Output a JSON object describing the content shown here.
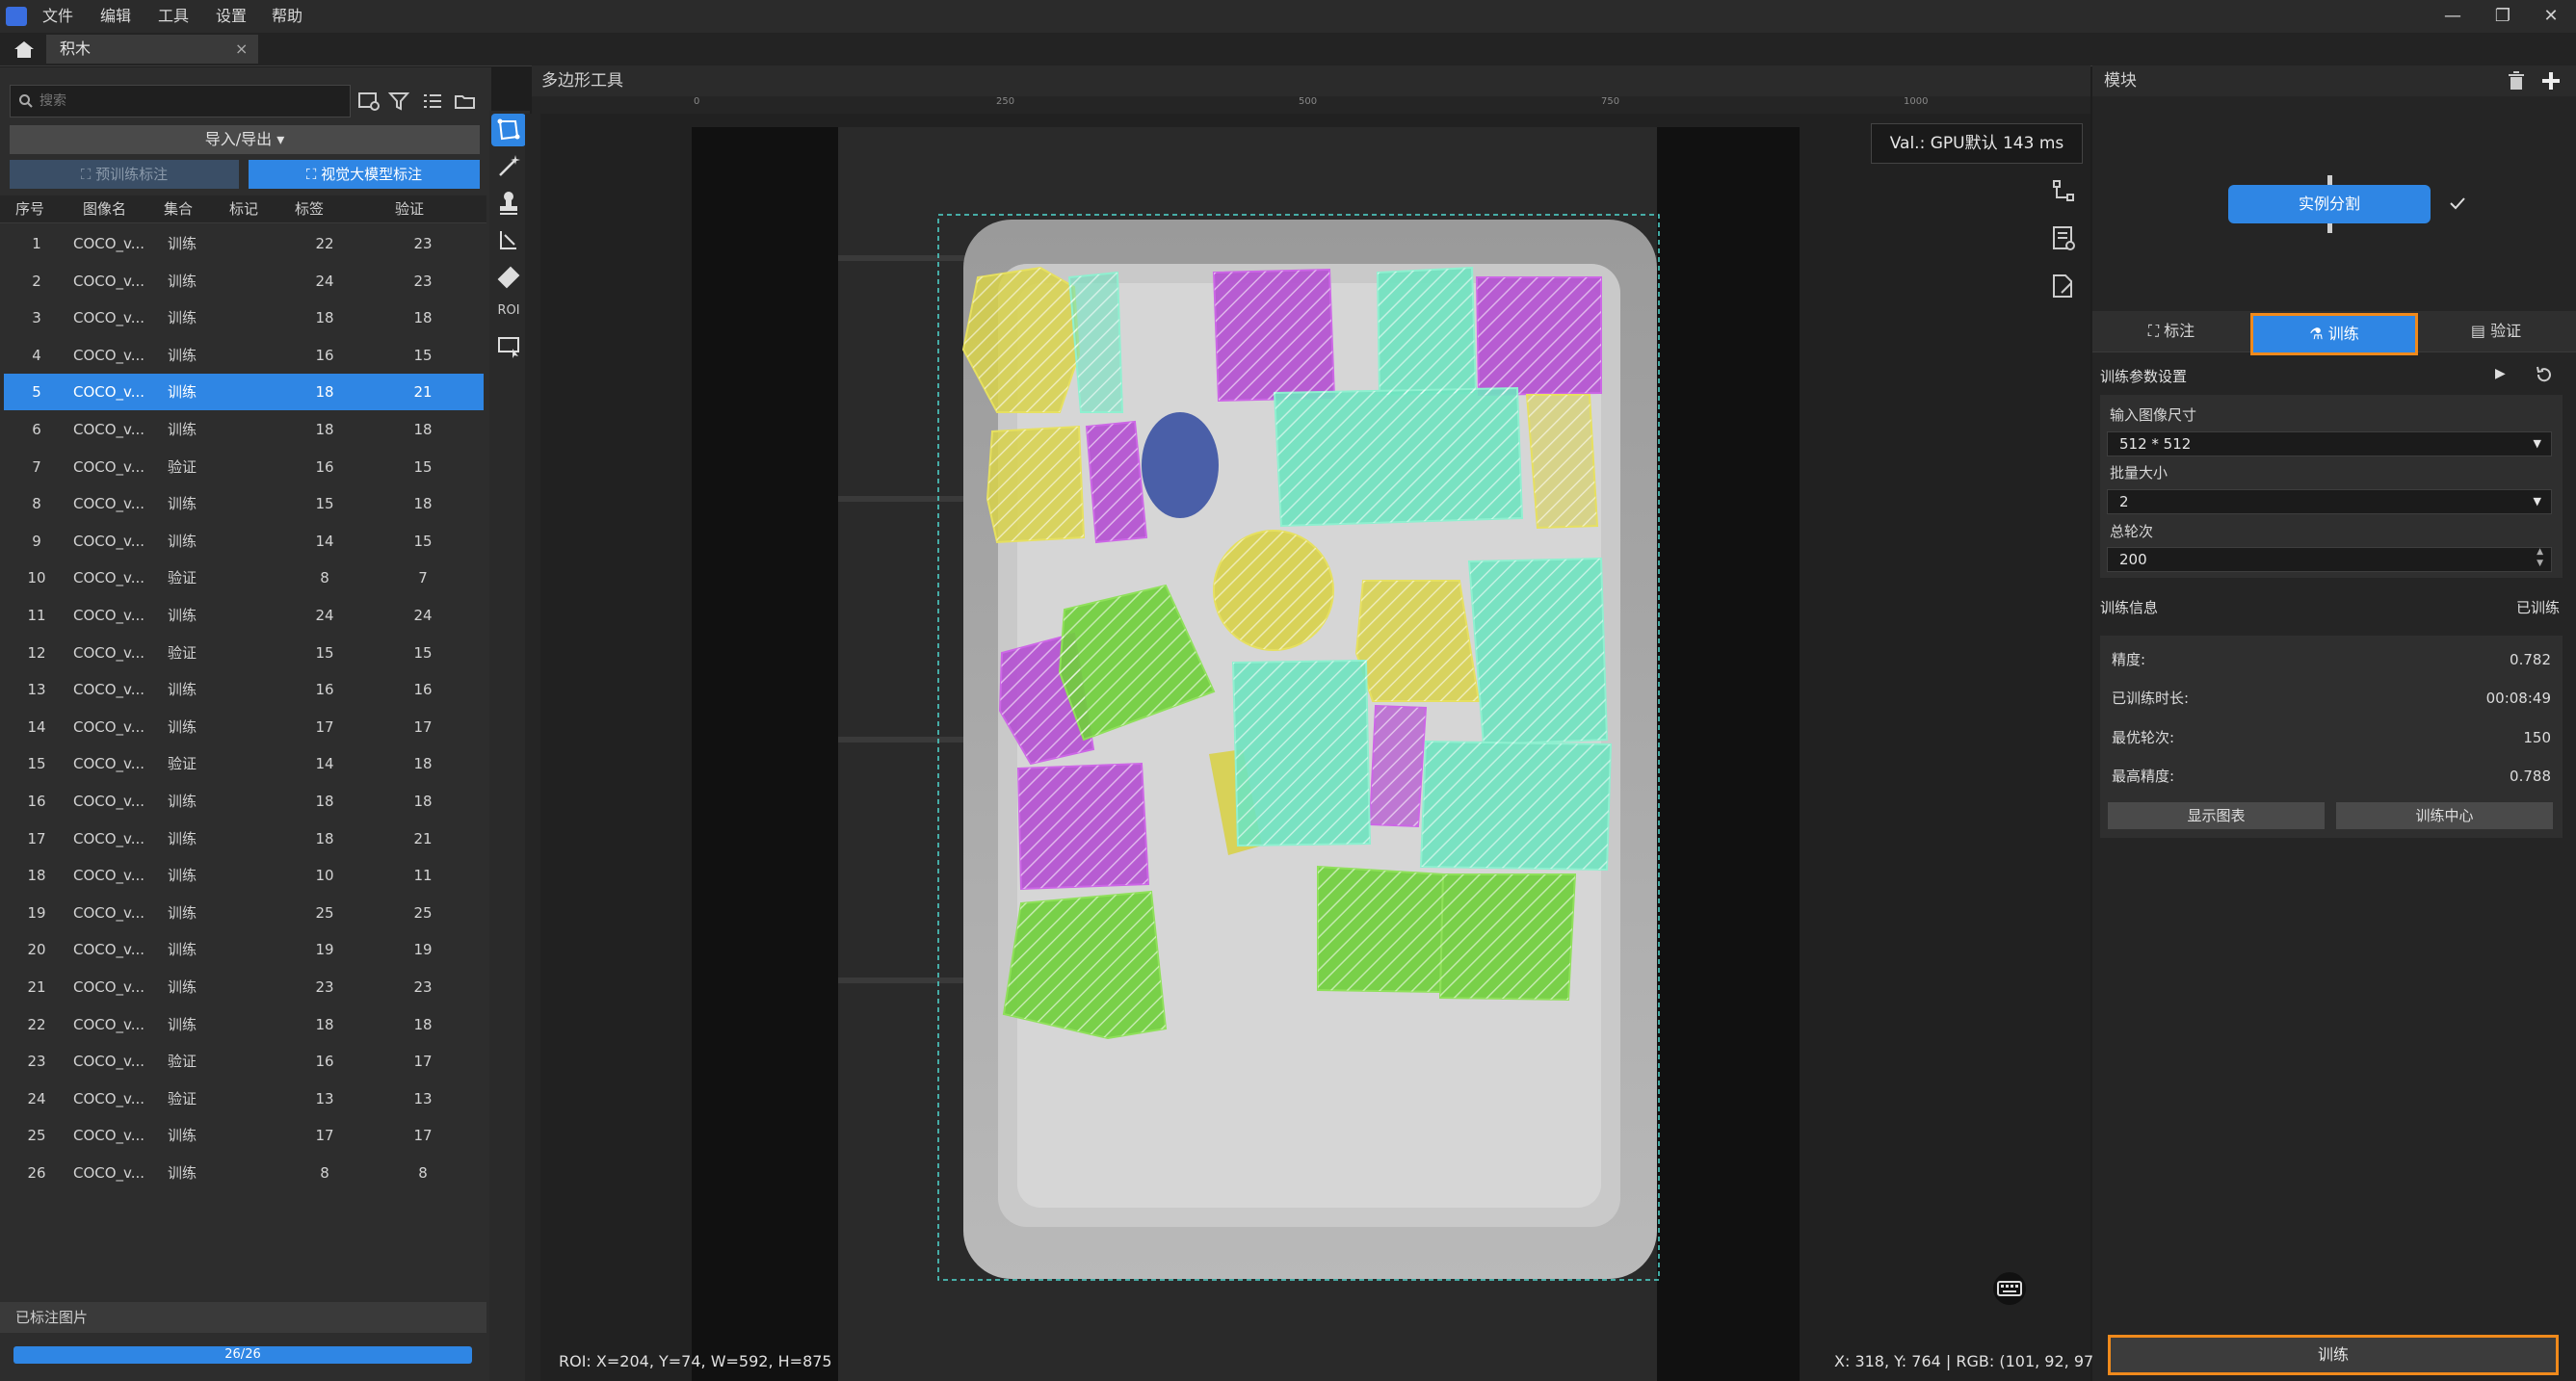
{
  "titlebar": {
    "menus": [
      "文件",
      "编辑",
      "工具",
      "设置",
      "帮助"
    ],
    "window_controls": [
      "—",
      "❐",
      "✕"
    ]
  },
  "document_tab": {
    "label": "积木",
    "close": "×"
  },
  "left": {
    "search": {
      "placeholder": "搜索"
    },
    "import_export_label": "导入/导出 ▾",
    "pretrain_label": "预训练标注",
    "vlm_label": "视觉大模型标注",
    "columns": [
      "序号",
      "图像名",
      "集合",
      "标记",
      "标签",
      "验证"
    ],
    "rows": [
      {
        "no": "1",
        "name": "COCO_v...",
        "set": "训练",
        "mark": "22",
        "verify": "23"
      },
      {
        "no": "2",
        "name": "COCO_v...",
        "set": "训练",
        "mark": "24",
        "verify": "23"
      },
      {
        "no": "3",
        "name": "COCO_v...",
        "set": "训练",
        "mark": "18",
        "verify": "18"
      },
      {
        "no": "4",
        "name": "COCO_v...",
        "set": "训练",
        "mark": "16",
        "verify": "15"
      },
      {
        "no": "5",
        "name": "COCO_v...",
        "set": "训练",
        "mark": "18",
        "verify": "21"
      },
      {
        "no": "6",
        "name": "COCO_v...",
        "set": "训练",
        "mark": "18",
        "verify": "18"
      },
      {
        "no": "7",
        "name": "COCO_v...",
        "set": "验证",
        "mark": "16",
        "verify": "15"
      },
      {
        "no": "8",
        "name": "COCO_v...",
        "set": "训练",
        "mark": "15",
        "verify": "18"
      },
      {
        "no": "9",
        "name": "COCO_v...",
        "set": "训练",
        "mark": "14",
        "verify": "15"
      },
      {
        "no": "10",
        "name": "COCO_v...",
        "set": "验证",
        "mark": "8",
        "verify": "7"
      },
      {
        "no": "11",
        "name": "COCO_v...",
        "set": "训练",
        "mark": "24",
        "verify": "24"
      },
      {
        "no": "12",
        "name": "COCO_v...",
        "set": "验证",
        "mark": "15",
        "verify": "15"
      },
      {
        "no": "13",
        "name": "COCO_v...",
        "set": "训练",
        "mark": "16",
        "verify": "16"
      },
      {
        "no": "14",
        "name": "COCO_v...",
        "set": "训练",
        "mark": "17",
        "verify": "17"
      },
      {
        "no": "15",
        "name": "COCO_v...",
        "set": "验证",
        "mark": "14",
        "verify": "18"
      },
      {
        "no": "16",
        "name": "COCO_v...",
        "set": "训练",
        "mark": "18",
        "verify": "18"
      },
      {
        "no": "17",
        "name": "COCO_v...",
        "set": "训练",
        "mark": "18",
        "verify": "21"
      },
      {
        "no": "18",
        "name": "COCO_v...",
        "set": "训练",
        "mark": "10",
        "verify": "11"
      },
      {
        "no": "19",
        "name": "COCO_v...",
        "set": "训练",
        "mark": "25",
        "verify": "25"
      },
      {
        "no": "20",
        "name": "COCO_v...",
        "set": "训练",
        "mark": "19",
        "verify": "19"
      },
      {
        "no": "21",
        "name": "COCO_v...",
        "set": "训练",
        "mark": "23",
        "verify": "23"
      },
      {
        "no": "22",
        "name": "COCO_v...",
        "set": "训练",
        "mark": "18",
        "verify": "18"
      },
      {
        "no": "23",
        "name": "COCO_v...",
        "set": "验证",
        "mark": "16",
        "verify": "17"
      },
      {
        "no": "24",
        "name": "COCO_v...",
        "set": "验证",
        "mark": "13",
        "verify": "13"
      },
      {
        "no": "25",
        "name": "COCO_v...",
        "set": "训练",
        "mark": "17",
        "verify": "17"
      },
      {
        "no": "26",
        "name": "COCO_v...",
        "set": "训练",
        "mark": "8",
        "verify": "8"
      }
    ],
    "selected_row": "5",
    "labeled_title": "已标注图片",
    "progress_text": "26/26",
    "progress": 1.0
  },
  "center": {
    "title": "多边形工具",
    "ruler_ticks": [
      "0",
      "250",
      "500",
      "750",
      "1000"
    ],
    "val_text": "Val.: GPU默认 143 ms",
    "roi_text": "ROI: X=204, Y=74, W=592, H=875",
    "roi_tool_label": "ROI",
    "xy_text": "X: 318, Y: 764 | RGB: (101, 92, 97)"
  },
  "right": {
    "title": "模块",
    "module_label": "实例分割",
    "tabs": [
      "标注",
      "训练",
      "验证"
    ],
    "params_title": "训练参数设置",
    "input_size_label": "输入图像尺寸",
    "input_size_value": "512 * 512",
    "batch_label": "批量大小",
    "batch_value": "2",
    "epochs_label": "总轮次",
    "epochs_value": "200",
    "info_title": "训练信息",
    "info_status": "已训练",
    "info": [
      {
        "label": "精度:",
        "value": "0.782"
      },
      {
        "label": "已训练时长:",
        "value": "00:08:49"
      },
      {
        "label": "最优轮次:",
        "value": "150"
      },
      {
        "label": "最高精度:",
        "value": "0.788"
      }
    ],
    "show_chart_label": "显示图表",
    "train_center_label": "训练中心",
    "train_button_label": "训练"
  },
  "colors": {
    "accent": "#2f86e4",
    "highlight": "#f08a1c",
    "yellow": "#d8d24a",
    "purple": "#b44fd2",
    "cyan": "#6fe3c0",
    "green": "#6fcf3a"
  }
}
